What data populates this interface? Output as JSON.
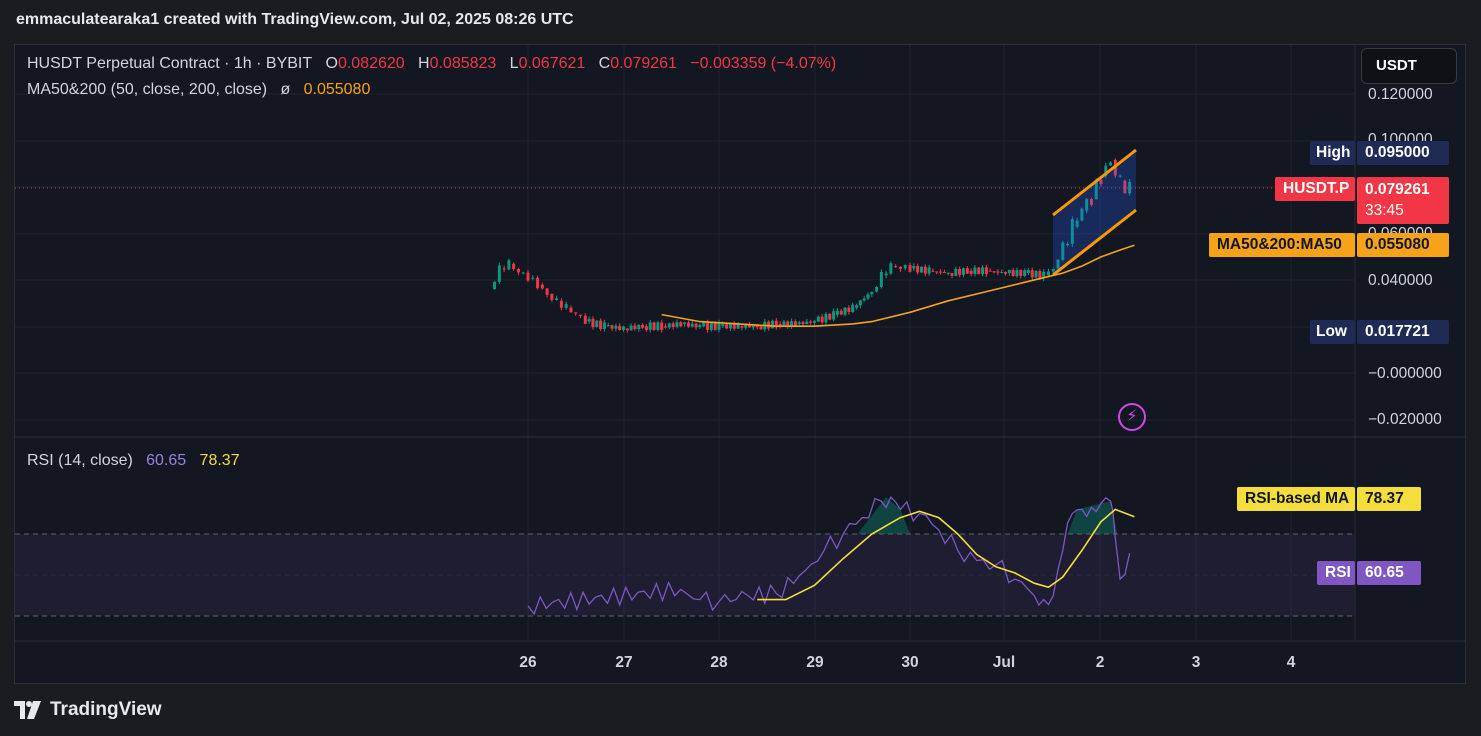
{
  "header": {
    "title": "emmaculatearaka1 created with TradingView.com, Jul 02, 2025 08:26 UTC"
  },
  "brand": {
    "name": "TradingView"
  },
  "legend": {
    "symbol_line": "HUSDT Perpetual Contract · 1h · BYBIT",
    "o_label": "O",
    "o_val": "0.082620",
    "h_label": "H",
    "h_val": "0.085823",
    "l_label": "L",
    "l_val": "0.067621",
    "c_label": "C",
    "c_val": "0.079261",
    "change": "−0.003359 (−4.07%)",
    "ma_text": "MA50&200 (50, close, 200, close)",
    "ma_sym": "ø",
    "ma_val": "0.055080",
    "rsi_text": "RSI (14, close)",
    "rsi_val": "60.65",
    "rsi_ma_val": "78.37"
  },
  "currency_button": "USDT",
  "price_axis": [
    "0.120000",
    "0.100000",
    "0.060000",
    "0.040000",
    "−0.000000",
    "−0.020000"
  ],
  "tags": {
    "high_label": "High",
    "high_val": "0.095000",
    "low_label": "Low",
    "low_val": "0.017721",
    "symbol": "HUSDT.P",
    "price": "0.079261",
    "countdown": "33:45",
    "ma_label": "MA50&200:MA50",
    "ma_val": "0.055080",
    "rsi_ma_label": "RSI-based MA",
    "rsi_ma_val": "78.37",
    "rsi_label": "RSI",
    "rsi_val": "60.65"
  },
  "time_axis": [
    "26",
    "27",
    "28",
    "29",
    "30",
    "Jul",
    "2",
    "3",
    "4"
  ],
  "colors": {
    "up": "#089981",
    "down": "#f23645",
    "ma": "#f7a21b",
    "rsi": "#7e57c2",
    "rsi_ma": "#f5dd3c",
    "channel": "#ff9800"
  },
  "chart_data": {
    "type": "candlestick",
    "symbol": "HUSDT Perpetual Contract",
    "interval": "1h",
    "exchange": "BYBIT",
    "ohlc_last": {
      "open": 0.08262,
      "high": 0.085823,
      "low": 0.067621,
      "close": 0.079261
    },
    "high": 0.095,
    "low": 0.017721,
    "price_series": {
      "x": [
        25.6,
        25.7,
        25.8,
        25.9,
        26.0,
        26.1,
        26.2,
        26.3,
        26.4,
        26.5,
        26.6,
        26.8,
        27.0,
        27.2,
        27.4,
        27.6,
        27.8,
        28.0,
        28.2,
        28.4,
        28.6,
        28.8,
        29.0,
        29.2,
        29.4,
        29.6,
        29.7,
        29.8,
        29.9,
        30.0,
        30.2,
        30.4,
        30.6,
        30.8,
        31.0,
        31.2,
        31.4,
        31.5,
        31.6,
        31.7,
        31.8,
        31.9,
        32.0,
        32.1,
        32.2,
        32.3
      ],
      "close": [
        0.036,
        0.045,
        0.047,
        0.043,
        0.041,
        0.038,
        0.034,
        0.031,
        0.028,
        0.025,
        0.022,
        0.02,
        0.019,
        0.02,
        0.02,
        0.021,
        0.02,
        0.02,
        0.02,
        0.02,
        0.021,
        0.021,
        0.022,
        0.025,
        0.028,
        0.035,
        0.042,
        0.046,
        0.045,
        0.045,
        0.044,
        0.043,
        0.044,
        0.044,
        0.043,
        0.043,
        0.042,
        0.045,
        0.055,
        0.063,
        0.07,
        0.075,
        0.085,
        0.092,
        0.083,
        0.079
      ]
    },
    "ma50": {
      "x": [
        27.4,
        27.8,
        28.2,
        28.6,
        29.0,
        29.4,
        29.6,
        30.0,
        30.4,
        30.8,
        31.2,
        31.6,
        31.8,
        32.0,
        32.2,
        32.35
      ],
      "values": [
        0.025,
        0.022,
        0.021,
        0.02,
        0.02,
        0.021,
        0.022,
        0.026,
        0.031,
        0.035,
        0.039,
        0.043,
        0.046,
        0.05,
        0.053,
        0.055
      ]
    },
    "rsi": {
      "x": [
        26.0,
        27.6,
        27.8,
        28.0,
        28.3,
        28.6,
        28.9,
        29.1,
        29.3,
        29.5,
        29.7,
        29.8,
        29.9,
        30.1,
        30.3,
        30.5,
        30.7,
        30.9,
        31.1,
        31.3,
        31.4,
        31.5,
        31.6,
        31.7,
        31.8,
        31.9,
        32.0,
        32.1,
        32.15,
        32.2,
        32.3
      ],
      "values": [
        35,
        43,
        38,
        37,
        40,
        41,
        52,
        62,
        70,
        78,
        86,
        88,
        82,
        80,
        72,
        62,
        57,
        55,
        48,
        40,
        38,
        40,
        62,
        80,
        82,
        83,
        85,
        86,
        68,
        48,
        60.65
      ]
    },
    "rsi_ma": {
      "x": [
        28.4,
        28.7,
        29.0,
        29.3,
        29.6,
        29.9,
        30.1,
        30.3,
        30.5,
        30.7,
        30.9,
        31.1,
        31.3,
        31.45,
        31.6,
        31.8,
        32.0,
        32.15,
        32.35
      ],
      "values": [
        38,
        38,
        45,
        58,
        70,
        78,
        81,
        78,
        70,
        60,
        54,
        51,
        46,
        44,
        49,
        62,
        76,
        82,
        78.37
      ]
    },
    "rsi_levels": [
      30,
      50,
      70
    ],
    "x_ticks": [
      "26",
      "27",
      "28",
      "29",
      "30",
      "Jul",
      "2",
      "3",
      "4"
    ],
    "y_ticks": [
      "0.120000",
      "0.100000",
      "0.060000",
      "0.040000",
      "−0.000000",
      "−0.020000"
    ]
  }
}
